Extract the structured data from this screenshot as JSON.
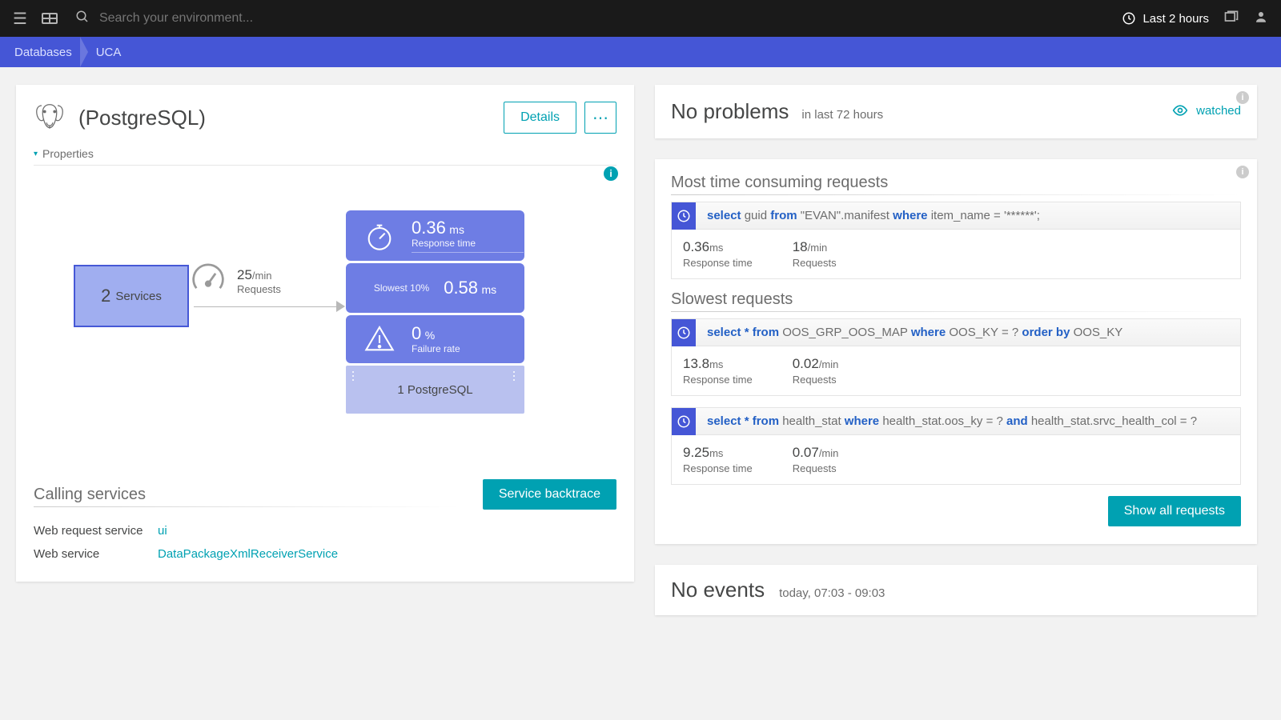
{
  "topbar": {
    "search_placeholder": "Search your environment...",
    "time_range": "Last 2 hours"
  },
  "breadcrumb": {
    "a": "Databases",
    "b": "UCA"
  },
  "db": {
    "name": "(PostgreSQL)",
    "details_btn": "Details",
    "properties": "Properties"
  },
  "flow": {
    "services": {
      "count": "2",
      "label": "Services"
    },
    "requests": {
      "value": "25",
      "unit": "/min",
      "label": "Requests"
    },
    "response": {
      "value": "0.36",
      "unit": "ms",
      "label": "Response time"
    },
    "slow10": {
      "label": "Slowest 10%",
      "value": "0.58",
      "unit": "ms"
    },
    "failure": {
      "value": "0",
      "unit": "%",
      "label": "Failure rate"
    },
    "node": "1 PostgreSQL"
  },
  "calling": {
    "title": "Calling services",
    "backtrace": "Service backtrace",
    "rows": {
      "r0k": "Web request service",
      "r0v": "ui",
      "r1k": "Web service",
      "r1v": "DataPackageXmlReceiverService"
    }
  },
  "problems": {
    "title": "No problems",
    "sub": "in last 72 hours",
    "watched": "watched"
  },
  "requests": {
    "most_title": "Most time consuming requests",
    "slow_title": "Slowest requests",
    "show_all": "Show all requests",
    "items": {
      "a": {
        "sql": {
          "p0": "select ",
          "p1": "guid ",
          "p2": "from ",
          "p3": "\"EVAN\".manifest ",
          "p4": "where ",
          "p5": "item_name = '******';"
        },
        "rt_v": "0.36",
        "rt_u": "ms",
        "rt_l": "Response time",
        "rq_v": "18",
        "rq_u": "/min",
        "rq_l": "Requests"
      },
      "b": {
        "sql": {
          "p0": "select ",
          "p1": "* ",
          "p2": "from ",
          "p3": "OOS_GRP_OOS_MAP ",
          "p4": "where ",
          "p5": "OOS_KY = ? ",
          "p6": "order by ",
          "p7": "OOS_KY"
        },
        "rt_v": "13.8",
        "rt_u": "ms",
        "rt_l": "Response time",
        "rq_v": "0.02",
        "rq_u": "/min",
        "rq_l": "Requests"
      },
      "c": {
        "sql": {
          "p0": "select ",
          "p1": "* ",
          "p2": "from ",
          "p3": "health_stat ",
          "p4": "where ",
          "p5": "health_stat.oos_ky = ? ",
          "p6": "and ",
          "p7": "health_stat.srvc_health_col = ?"
        },
        "rt_v": "9.25",
        "rt_u": "ms",
        "rt_l": "Response time",
        "rq_v": "0.07",
        "rq_u": "/min",
        "rq_l": "Requests"
      }
    }
  },
  "events": {
    "title": "No events",
    "sub": "today, 07:03 - 09:03"
  }
}
